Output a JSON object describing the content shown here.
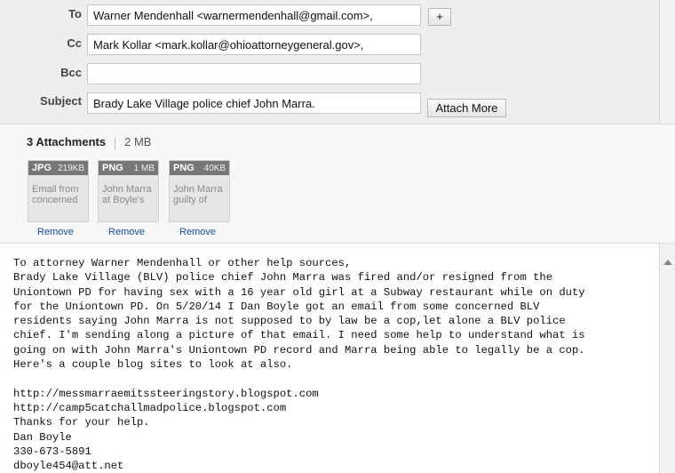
{
  "compose": {
    "to_label": "To",
    "to_value": "Warner Mendenhall <warnermendenhall@gmail.com>,",
    "add_label": "+",
    "cc_label": "Cc",
    "cc_value": "Mark Kollar <mark.kollar@ohioattorneygeneral.gov>,",
    "bcc_label": "Bcc",
    "bcc_value": "",
    "subject_label": "Subject",
    "subject_value": "Brady Lake Village police chief John Marra.",
    "attach_more_label": "Attach More"
  },
  "attachments": {
    "count_label": "3 Attachments",
    "total_size": "2 MB",
    "remove_label": "Remove",
    "items": [
      {
        "type": "JPG",
        "size": "219KB",
        "name": "Email from concerned"
      },
      {
        "type": "PNG",
        "size": "1 MB",
        "name": "John Marra at Boyle's"
      },
      {
        "type": "PNG",
        "size": "40KB",
        "name": "John Marra guilty of"
      }
    ]
  },
  "body": {
    "text": "To attorney Warner Mendenhall or other help sources,\nBrady Lake Village (BLV) police chief John Marra was fired and/or resigned from the\nUniontown PD for having sex with a 16 year old girl at a Subway restaurant while on duty\nfor the Uniontown PD. On 5/20/14 I Dan Boyle got an email from some concerned BLV\nresidents saying John Marra is not supposed to by law be a cop,let alone a BLV police\nchief. I'm sending along a picture of that email. I need some help to understand what is\ngoing on with John Marra's Uniontown PD record and Marra being able to legally be a cop.\nHere's a couple blog sites to look at also.\n\nhttp://messmarraemitssteeringstory.blogspot.com\nhttp://camp5catchallmadpolice.blogspot.com\nThanks for your help.\nDan Boyle\n330-673-5891\ndboyle454@att.net"
  },
  "icons": {
    "scroll_up": "chevron-up-icon"
  }
}
